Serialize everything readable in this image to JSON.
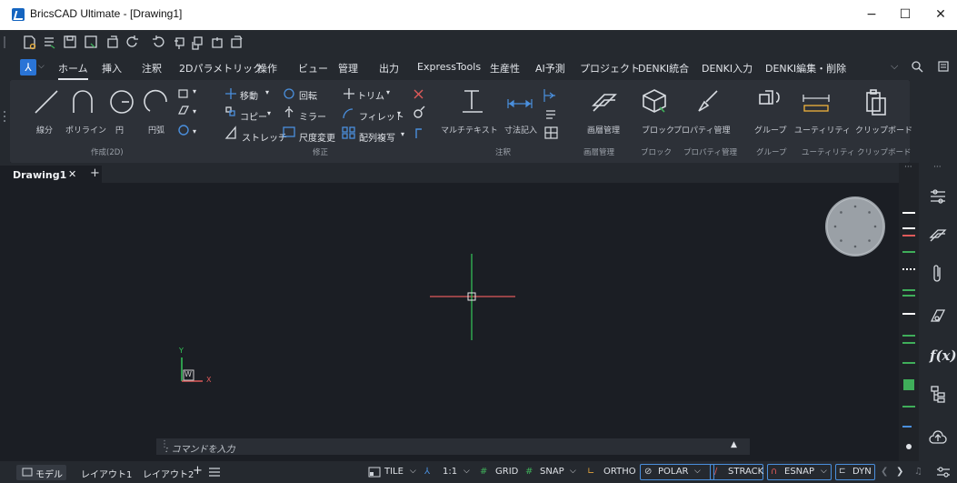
{
  "window": {
    "title": "BricsCAD Ultimate - [Drawing1]",
    "minimize": "−",
    "maximize": "☐",
    "close": "✕"
  },
  "ribbon_tabs": [
    "ホーム",
    "挿入",
    "注釈",
    "2Dパラメトリック",
    "操作",
    "ビュー",
    "管理",
    "出力",
    "ExpressTools",
    "生産性",
    "AI予測",
    "プロジェクト",
    "DENKI統合",
    "DENKI入力",
    "DENKI編集・削除"
  ],
  "ribbon": {
    "draw": {
      "line": "線分",
      "polyline": "ポリライン",
      "circle": "円",
      "arc": "円弧",
      "group_label": "作成(2D)"
    },
    "modify": {
      "move": "移動",
      "rotate": "回転",
      "trim": "トリム",
      "copy": "コピー",
      "mirror": "ミラー",
      "fillet": "フィレット",
      "stretch": "ストレッチ",
      "scale": "尺度変更",
      "array": "配列複写",
      "group_label": "修正"
    },
    "annotation": {
      "mtext": "マルチテキスト",
      "dimension": "寸法記入",
      "group_label": "注釈"
    },
    "layers": {
      "label": "画層管理",
      "group_label": "画層管理"
    },
    "block": {
      "label": "ブロック",
      "group_label": "ブロック"
    },
    "properties": {
      "label": "プロパティ管理",
      "group_label": "プロパティ管理"
    },
    "groups": {
      "label": "グループ",
      "group_label": "グループ"
    },
    "utilities": {
      "label": "ユーティリティ",
      "group_label": "ユーティリティ"
    },
    "clipboard": {
      "label": "クリップボード",
      "group_label": "クリップボード"
    }
  },
  "doc_tabs": {
    "active": "Drawing1",
    "close": "✕",
    "add": "+"
  },
  "command_line": {
    "prompt": ": コマンドを入力"
  },
  "ucs": {
    "x": "X",
    "y": "Y",
    "w": "W"
  },
  "status": {
    "model_tab": "モデル",
    "layout1": "レイアウト1",
    "layout2": "レイアウト2",
    "tile": "TILE",
    "scale": "1:1",
    "grid": "GRID",
    "snap": "SNAP",
    "ortho": "ORTHO",
    "polar": "POLAR",
    "strack": "STRACK",
    "esnap": "ESNAP",
    "dyn": "DYN"
  },
  "right_panel": {
    "fx": "f(x)"
  },
  "colors": {
    "accent": "#2a74d6",
    "bg": "#1b1e24",
    "crosshair_x": "#e05a5a",
    "crosshair_y": "#34c759"
  }
}
